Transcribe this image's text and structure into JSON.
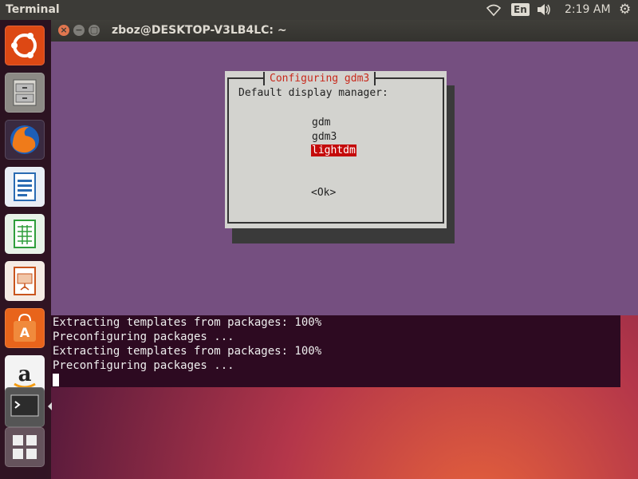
{
  "top_panel": {
    "app_title": "Terminal",
    "language": "En",
    "time": "2:19 AM",
    "icons": [
      "wifi-icon",
      "volume-icon",
      "settings-gear-icon"
    ]
  },
  "launcher": {
    "items": [
      {
        "name": "ubuntu-dash",
        "icon": "ubuntu-logo-icon",
        "color": "#dd4814"
      },
      {
        "name": "files",
        "icon": "file-cabinet-icon",
        "color": "#9a9791"
      },
      {
        "name": "firefox",
        "icon": "firefox-icon",
        "color": "#e66000"
      },
      {
        "name": "libreoffice-writer",
        "icon": "writer-document-icon",
        "color": "#2a6bb3"
      },
      {
        "name": "libreoffice-calc",
        "icon": "calc-spreadsheet-icon",
        "color": "#2e9e3b"
      },
      {
        "name": "libreoffice-impress",
        "icon": "impress-presentation-icon",
        "color": "#c9541d"
      },
      {
        "name": "software-center",
        "icon": "shopping-bag-icon",
        "color": "#e8641b"
      },
      {
        "name": "amazon",
        "icon": "amazon-icon",
        "color": "#f3f3f3"
      },
      {
        "name": "terminal",
        "icon": "terminal-icon",
        "color": "#444"
      }
    ]
  },
  "window": {
    "title": "zboz@DESKTOP-V3LB4LC: ~",
    "buttons": {
      "close": "×",
      "minimize": "−",
      "maximize": "▢"
    }
  },
  "dialog": {
    "title": "Configuring gdm3",
    "prompt": "Default display manager:",
    "options": [
      "gdm",
      "gdm3",
      "lightdm"
    ],
    "selected": "lightdm",
    "ok_label": "<Ok>"
  },
  "terminal": {
    "lines": [
      "Extracting templates from packages: 100%",
      "Preconfiguring packages ...",
      "Extracting templates from packages: 100%",
      "Preconfiguring packages ..."
    ]
  }
}
